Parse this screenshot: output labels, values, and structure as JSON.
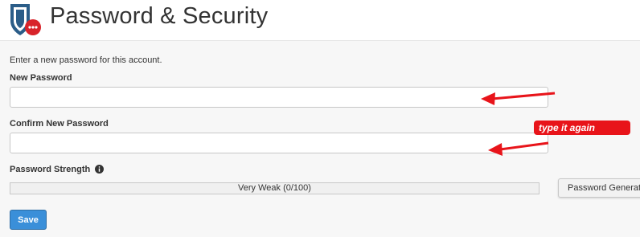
{
  "header": {
    "title": "Password & Security",
    "logo_icon": "shield-lock-icon"
  },
  "form": {
    "intro": "Enter a new password for this account.",
    "new_password_label": "New Password",
    "new_password_value": "",
    "confirm_password_label": "Confirm New Password",
    "confirm_password_value": "",
    "strength_label": "Password Strength",
    "strength_info_icon": "info-icon",
    "strength_text": "Very Weak (0/100)",
    "strength_score": 0,
    "generator_button": "Password Generator",
    "save_button": "Save"
  },
  "annotations": {
    "note": "type it again",
    "color": "#e8141a"
  },
  "colors": {
    "primary": "#3a8fd9",
    "danger": "#d9534f"
  }
}
